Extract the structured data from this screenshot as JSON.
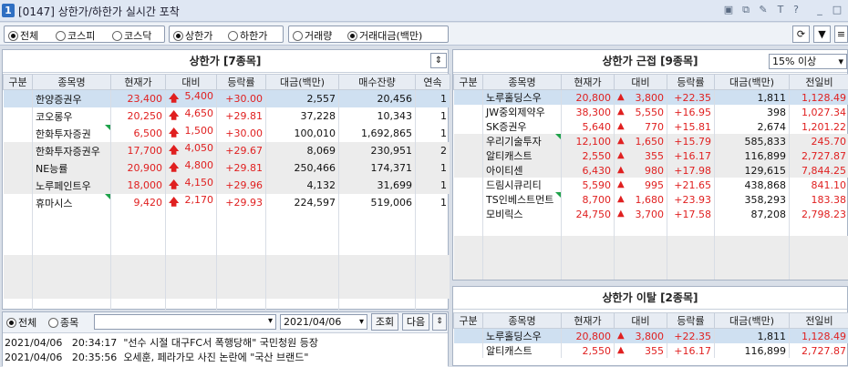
{
  "window": {
    "number": "1",
    "title": "[0147] 상한가/하한가 실시간 포착"
  },
  "options": {
    "market": [
      "전체",
      "코스피",
      "코스닥"
    ],
    "limit": [
      "상한가",
      "하한가"
    ],
    "sort": [
      "거래량",
      "거래대금(백만)"
    ]
  },
  "upper": {
    "title": "상한가 [7종목]",
    "headers": [
      "구분",
      "종목명",
      "현재가",
      "대비",
      "등락률",
      "대금(백만)",
      "매수잔량",
      "연속"
    ],
    "rows": [
      {
        "name": "한양증권우",
        "price": "23,400",
        "diff": "5,400",
        "rate": "+30.00",
        "amt": "2,557",
        "bid": "20,456",
        "cont": "1"
      },
      {
        "name": "코오롱우",
        "price": "20,250",
        "diff": "4,650",
        "rate": "+29.81",
        "amt": "37,228",
        "bid": "10,343",
        "cont": "1"
      },
      {
        "name": "한화투자증권",
        "price": "6,500",
        "diff": "1,500",
        "rate": "+30.00",
        "amt": "100,010",
        "bid": "1,692,865",
        "cont": "1"
      },
      {
        "name": "한화투자증권우",
        "price": "17,700",
        "diff": "4,050",
        "rate": "+29.67",
        "amt": "8,069",
        "bid": "230,951",
        "cont": "2"
      },
      {
        "name": "NE능률",
        "price": "20,900",
        "diff": "4,800",
        "rate": "+29.81",
        "amt": "250,466",
        "bid": "174,371",
        "cont": "1"
      },
      {
        "name": "노루페인트우",
        "price": "18,000",
        "diff": "4,150",
        "rate": "+29.96",
        "amt": "4,132",
        "bid": "31,699",
        "cont": "1"
      },
      {
        "name": "휴마시스",
        "price": "9,420",
        "diff": "2,170",
        "rate": "+29.93",
        "amt": "224,597",
        "bid": "519,006",
        "cont": "1"
      }
    ]
  },
  "near": {
    "title": "상한가 근접 [9종목]",
    "filter": "15% 이상",
    "headers": [
      "구분",
      "종목명",
      "현재가",
      "대비",
      "등락률",
      "대금(백만)",
      "전일비"
    ],
    "rows": [
      {
        "name": "노루홀딩스우",
        "price": "20,800",
        "diff": "3,800",
        "rate": "+22.35",
        "amt": "1,811",
        "prev": "1,128.49"
      },
      {
        "name": "JW중외제약우",
        "price": "38,300",
        "diff": "5,550",
        "rate": "+16.95",
        "amt": "398",
        "prev": "1,027.34"
      },
      {
        "name": "SK증권우",
        "price": "5,640",
        "diff": "770",
        "rate": "+15.81",
        "amt": "2,674",
        "prev": "1,201.22"
      },
      {
        "name": "우리기술투자",
        "price": "12,100",
        "diff": "1,650",
        "rate": "+15.79",
        "amt": "585,833",
        "prev": "245.70"
      },
      {
        "name": "알티캐스트",
        "price": "2,550",
        "diff": "355",
        "rate": "+16.17",
        "amt": "116,899",
        "prev": "2,727.87"
      },
      {
        "name": "아이티센",
        "price": "6,430",
        "diff": "980",
        "rate": "+17.98",
        "amt": "129,615",
        "prev": "7,844.25"
      },
      {
        "name": "드림시큐리티",
        "price": "5,590",
        "diff": "995",
        "rate": "+21.65",
        "amt": "438,868",
        "prev": "841.10"
      },
      {
        "name": "TS인베스트먼트",
        "price": "8,700",
        "diff": "1,680",
        "rate": "+23.93",
        "amt": "358,293",
        "prev": "183.38"
      },
      {
        "name": "모비릭스",
        "price": "24,750",
        "diff": "3,700",
        "rate": "+17.58",
        "amt": "87,208",
        "prev": "2,798.23"
      }
    ]
  },
  "leave": {
    "title": "상한가 이탈 [2종목]",
    "headers": [
      "구분",
      "종목명",
      "현재가",
      "대비",
      "등락률",
      "대금(백만)",
      "전일비"
    ],
    "rows": [
      {
        "name": "노루홀딩스우",
        "price": "20,800",
        "diff": "3,800",
        "rate": "+22.35",
        "amt": "1,811",
        "prev": "1,128.49"
      },
      {
        "name": "알티캐스트",
        "price": "2,550",
        "diff": "355",
        "rate": "+16.17",
        "amt": "116,899",
        "prev": "2,727.87"
      }
    ]
  },
  "news": {
    "scope": [
      "전체",
      "종목"
    ],
    "date": "2021/04/06",
    "search": "조회",
    "next": "다음",
    "items": [
      {
        "date": "2021/04/06",
        "time": "20:34:17",
        "text": "\"선수 시절 대구FC서 폭행당해\" 국민청원 등장"
      },
      {
        "date": "2021/04/06",
        "time": "20:35:56",
        "text": "오세훈, 페라가모 사진 논란에 \"국산 브랜드\""
      }
    ]
  }
}
